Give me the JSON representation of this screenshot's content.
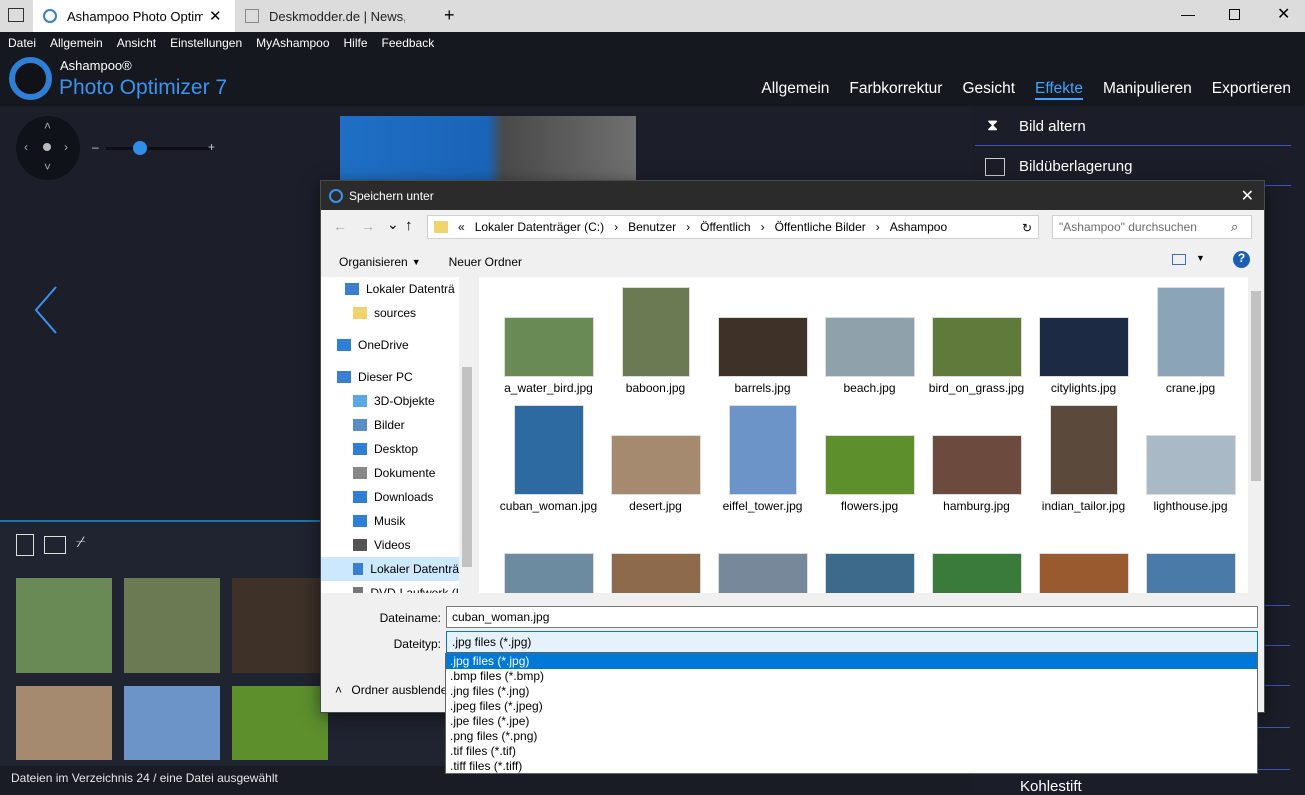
{
  "browser": {
    "tabs": [
      {
        "title": "Ashampoo Photo Optim",
        "active": true
      },
      {
        "title": "Deskmodder.de | News, Tip",
        "active": false
      }
    ],
    "window_controls": [
      "minimize",
      "maximize",
      "close"
    ]
  },
  "app": {
    "menu": [
      "Datei",
      "Allgemein",
      "Ansicht",
      "Einstellungen",
      "MyAshampoo",
      "Hilfe",
      "Feedback"
    ],
    "brand_top": "Ashampoo®",
    "brand_name": "Photo Optimizer 7",
    "nav_tabs": [
      "Allgemein",
      "Farbkorrektur",
      "Gesicht",
      "Effekte",
      "Manipulieren",
      "Exportieren"
    ],
    "active_tab": "Effekte",
    "effects": [
      "Bild altern",
      "Bildüberlagerung"
    ],
    "partial_effect": "Kohlestift",
    "status": "Dateien im Verzeichnis 24 / eine Datei ausgewählt",
    "zoom_minus": "–",
    "zoom_plus": "+"
  },
  "dialog": {
    "title": "Speichern unter",
    "breadcrumb": [
      "«",
      "Lokaler Datenträger (C:)",
      "Benutzer",
      "Öffentlich",
      "Öffentliche Bilder",
      "Ashampoo"
    ],
    "search_placeholder": "\"Ashampoo\" durchsuchen",
    "toolbar": {
      "organize": "Organisieren",
      "new_folder": "Neuer Ordner"
    },
    "nav_items": [
      {
        "label": "Lokaler Datenträ",
        "icon": "drive-icon"
      },
      {
        "label": "sources",
        "icon": "folder-icon"
      },
      {
        "label": "OneDrive",
        "icon": "cloud-icon"
      },
      {
        "label": "Dieser PC",
        "icon": "pc-icon"
      },
      {
        "label": "3D-Objekte",
        "icon": "cube-icon"
      },
      {
        "label": "Bilder",
        "icon": "pictures-icon"
      },
      {
        "label": "Desktop",
        "icon": "desktop-icon"
      },
      {
        "label": "Dokumente",
        "icon": "documents-icon"
      },
      {
        "label": "Downloads",
        "icon": "download-icon"
      },
      {
        "label": "Musik",
        "icon": "music-icon"
      },
      {
        "label": "Videos",
        "icon": "video-icon"
      },
      {
        "label": "Lokaler Datenträ",
        "icon": "drive-icon"
      },
      {
        "label": "DVD-Laufwerk (I",
        "icon": "dvd-icon"
      }
    ],
    "files": [
      {
        "name": "a_water_bird.jpg",
        "color": "#6a8a55"
      },
      {
        "name": "baboon.jpg",
        "color": "#6b7a53"
      },
      {
        "name": "barrels.jpg",
        "color": "#3d3128"
      },
      {
        "name": "beach.jpg",
        "color": "#8fa1ab"
      },
      {
        "name": "bird_on_grass.jpg",
        "color": "#5f7a3a"
      },
      {
        "name": "citylights.jpg",
        "color": "#1d2a44"
      },
      {
        "name": "crane.jpg",
        "color": "#8ba4b8"
      },
      {
        "name": "cuban_woman.jpg",
        "color": "#2d6aa2"
      },
      {
        "name": "desert.jpg",
        "color": "#a58a6f"
      },
      {
        "name": "eiffel_tower.jpg",
        "color": "#6c94c8"
      },
      {
        "name": "flowers.jpg",
        "color": "#5d8f2d"
      },
      {
        "name": "hamburg.jpg",
        "color": "#6d4a3e"
      },
      {
        "name": "indian_tailor.jpg",
        "color": "#5b4a3c"
      },
      {
        "name": "lighthouse.jpg",
        "color": "#a9b9c6"
      },
      {
        "name": "",
        "color": "#6c8aa0"
      },
      {
        "name": "",
        "color": "#8e6a4c"
      },
      {
        "name": "",
        "color": "#77889a"
      },
      {
        "name": "",
        "color": "#3d6a8a"
      },
      {
        "name": "",
        "color": "#3a7a3a"
      },
      {
        "name": "",
        "color": "#9a5a30"
      },
      {
        "name": "",
        "color": "#4a7aa8"
      }
    ],
    "filename_label": "Dateiname:",
    "filename_value": "cuban_woman.jpg",
    "filetype_label": "Dateityp:",
    "filetype_value": ".jpg files  (*.jpg)",
    "hide_folders": "Ordner ausblende",
    "filetype_options": [
      ".jpg files  (*.jpg)",
      ".bmp files  (*.bmp)",
      ".jng files  (*.jng)",
      ".jpeg files  (*.jpeg)",
      ".jpe files  (*.jpe)",
      ".png files  (*.png)",
      ".tif files  (*.tif)",
      ".tiff files  (*.tiff)"
    ]
  },
  "colors": {
    "accent": "#41a3ff",
    "brand_blue": "#2f7fd6",
    "selection": "#0078d7"
  }
}
